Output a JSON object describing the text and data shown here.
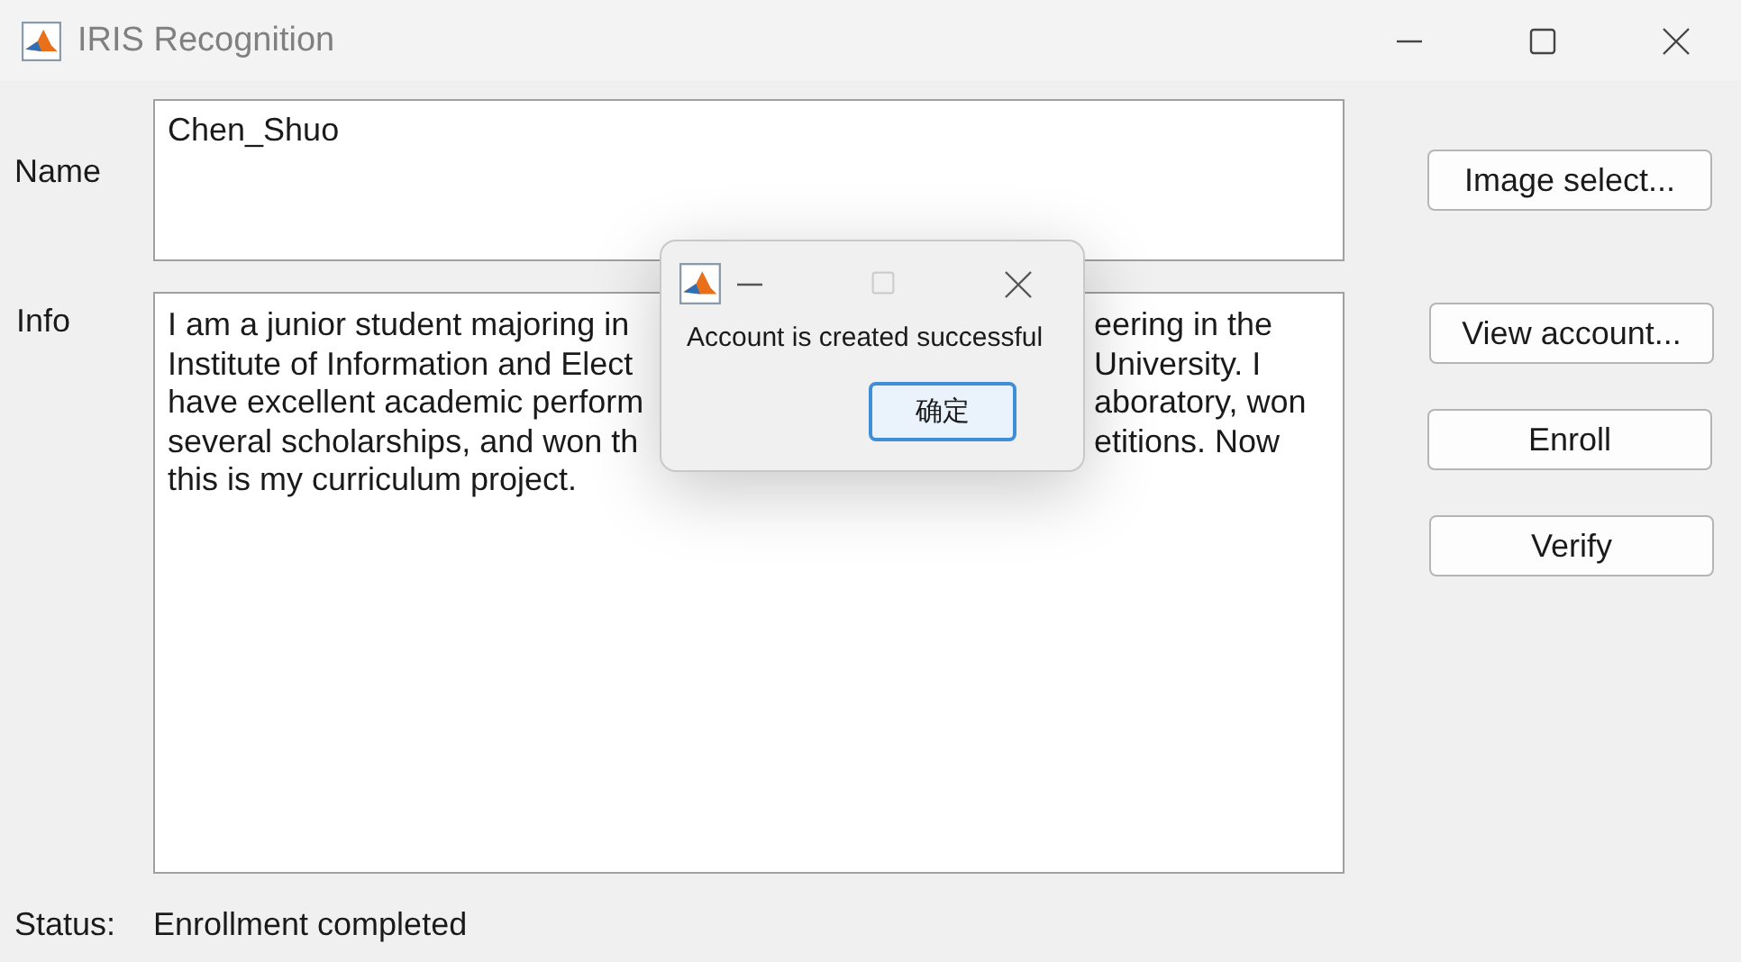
{
  "window": {
    "title": "IRIS Recognition"
  },
  "name": {
    "label": "Name",
    "value": "Chen_Shuo"
  },
  "info": {
    "label": "Info",
    "lines": [
      {
        "left": "I am a junior student majoring in",
        "right": "eering in the"
      },
      {
        "left": "Institute of Information and Elect",
        "right": "University. I"
      },
      {
        "left": "have excellent academic perform",
        "right": "aboratory, won"
      },
      {
        "left": "several scholarships, and won th",
        "right": "etitions. Now"
      },
      {
        "left": "this is my curriculum project."
      }
    ]
  },
  "buttons": [
    "Image select...",
    "View account...",
    "Enroll",
    "Verify"
  ],
  "status": {
    "label": "Status:",
    "value": "Enrollment completed"
  },
  "dialog": {
    "message": "Account is created successful",
    "button": {
      "label": "确定",
      "focused": true
    }
  }
}
